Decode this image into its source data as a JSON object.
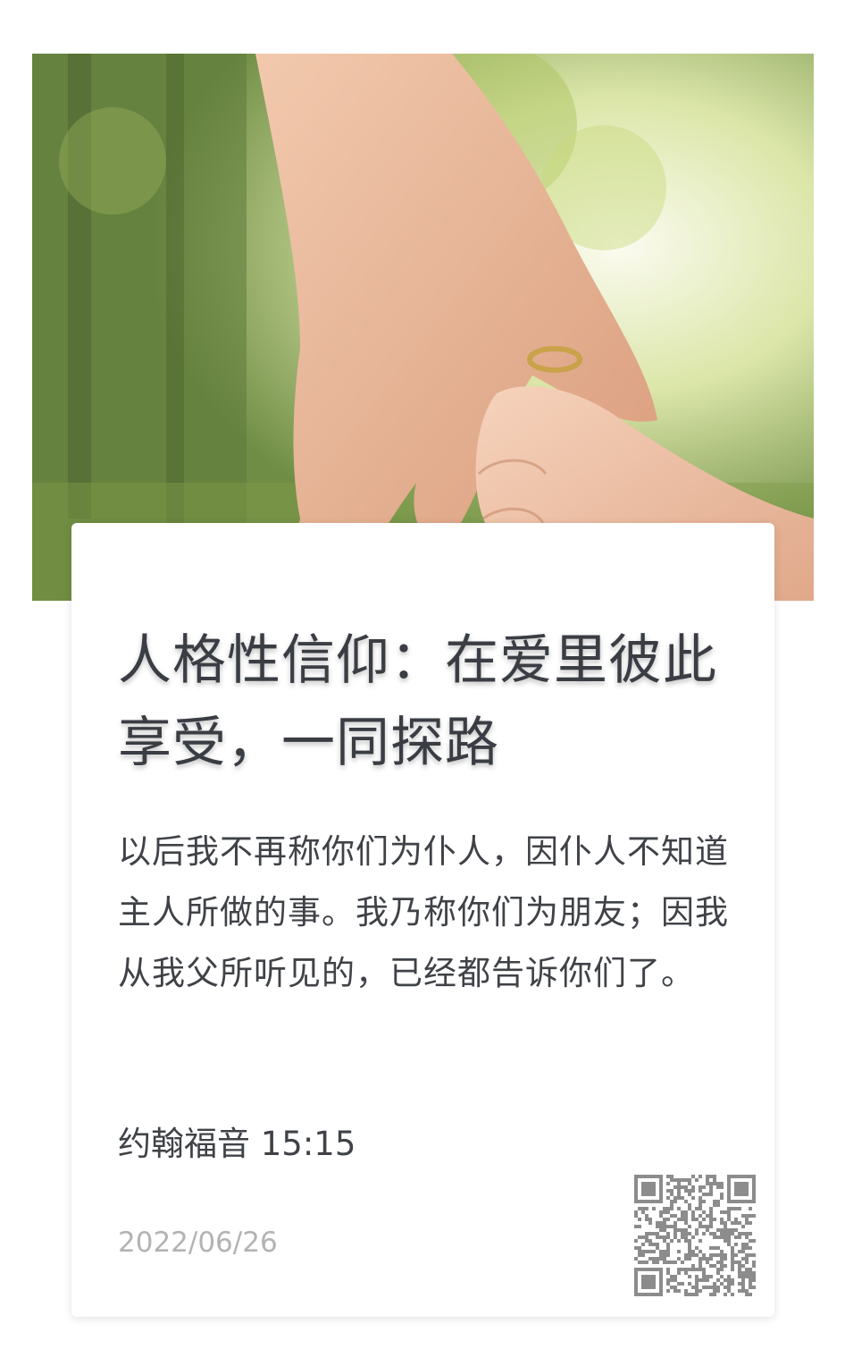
{
  "post": {
    "title": "人格性信仰：在爱里彼此享受，一同探路",
    "quote": "以后我不再称你们为仆人，因仆人不知道主人所做的事。我乃称你们为朋友；因我从我父所听见的，已经都告诉你们了。",
    "reference": "约翰福音 15:15",
    "date": "2022/06/26"
  },
  "hero": {
    "subject": "adult hand holding child hand"
  },
  "qr": {
    "icon": "qr-code-icon"
  },
  "colors": {
    "title": "#3a3d44",
    "body": "#3f4247",
    "date": "#b3b3b3",
    "foliage": "#8aa85a",
    "skin": "#e9b89b"
  }
}
